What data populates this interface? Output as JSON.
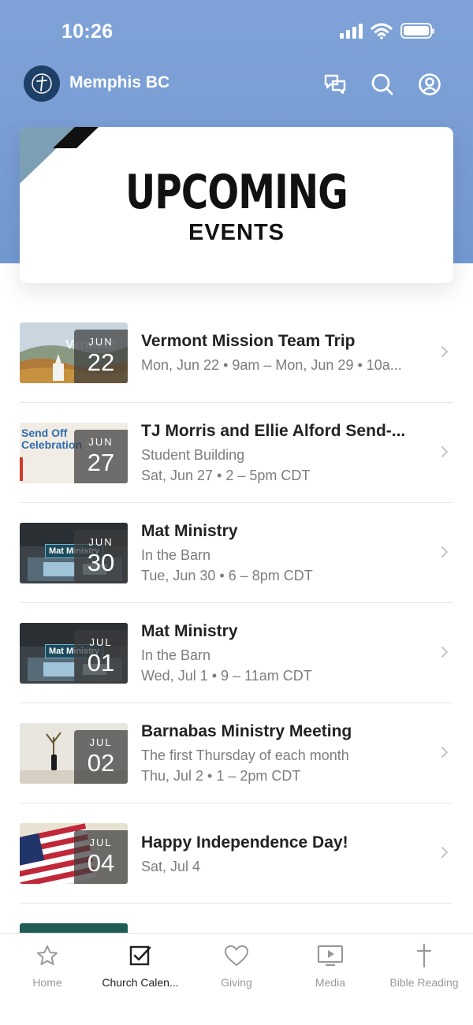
{
  "status_bar": {
    "time": "10:26"
  },
  "app_bar": {
    "title": "Memphis BC",
    "icons": [
      "messages-icon",
      "search-icon",
      "profile-icon"
    ]
  },
  "hero": {
    "title": "UPCOMING",
    "subtitle": "EVENTS"
  },
  "events": [
    {
      "title": "Vermont Mission Team Trip",
      "lines": [
        "Mon, Jun 22 • 9am – Mon, Jun 29 • 10a..."
      ],
      "month": "JUN",
      "day": "22",
      "thumb_text": "Vermont"
    },
    {
      "title": "TJ Morris and Ellie Alford Send-...",
      "lines": [
        "Student Building",
        "Sat, Jun 27 • 2 – 5pm CDT"
      ],
      "month": "JUN",
      "day": "27",
      "thumb_text": "Send Off Celebration"
    },
    {
      "title": "Mat Ministry",
      "lines": [
        "In the Barn",
        "Tue, Jun 30 • 6 – 8pm CDT"
      ],
      "month": "JUN",
      "day": "30",
      "thumb_text": "Mat Ministry"
    },
    {
      "title": "Mat Ministry",
      "lines": [
        "In the Barn",
        "Wed, Jul 1 • 9 – 11am CDT"
      ],
      "month": "JUL",
      "day": "01",
      "thumb_text": "Mat Ministry"
    },
    {
      "title": "Barnabas Ministry Meeting",
      "lines": [
        "The first Thursday of each month",
        "Thu, Jul 2 • 1 – 2pm CDT"
      ],
      "month": "JUL",
      "day": "02",
      "thumb_text": ""
    },
    {
      "title": "Happy Independence Day!",
      "lines": [
        "Sat, Jul 4"
      ],
      "month": "JUL",
      "day": "04",
      "thumb_text": ""
    }
  ],
  "tabs": [
    {
      "label": "Home",
      "icon": "star-icon",
      "active": false
    },
    {
      "label": "Church Calen...",
      "icon": "checkbox-icon",
      "active": true
    },
    {
      "label": "Giving",
      "icon": "heart-icon",
      "active": false
    },
    {
      "label": "Media",
      "icon": "media-play-icon",
      "active": false
    },
    {
      "label": "Bible Reading",
      "icon": "cross-icon",
      "active": false
    }
  ],
  "colors": {
    "header": "#7399d2",
    "logo": "#1e3f66",
    "active_tab": "#222222",
    "inactive_tab": "#999999"
  }
}
